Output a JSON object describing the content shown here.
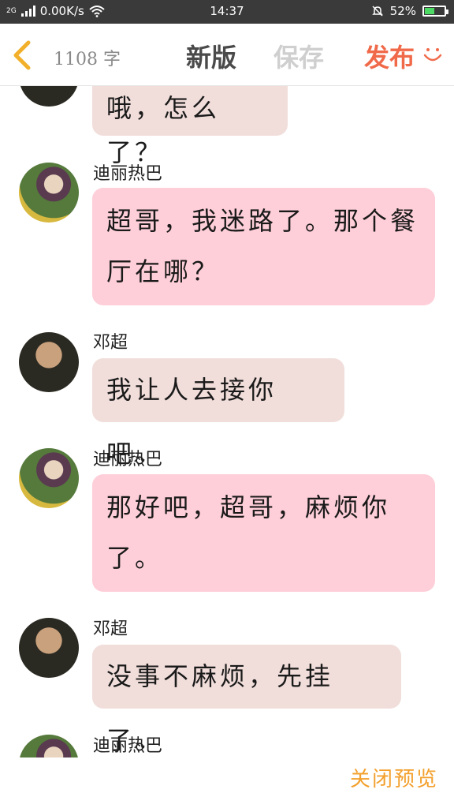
{
  "status_bar": {
    "network": "2G",
    "speed": "0.00K/s",
    "time": "14:37",
    "battery": "52%",
    "battery_level": 0.52
  },
  "header": {
    "back_icon": "chevron-left-icon",
    "word_count": "1108 字",
    "new_version_label": "新版",
    "save_label": "保存",
    "publish_label": "发布",
    "smile_icon": "smile-icon"
  },
  "messages": [
    {
      "speaker": "",
      "text": "哦，怎么了？"
    },
    {
      "speaker": "迪丽热巴",
      "lines": [
        "超哥，我迷路了。那个餐",
        "厅在哪？"
      ]
    },
    {
      "speaker": "邓超",
      "text": "我让人去接你吧。"
    },
    {
      "speaker": "迪丽热巴",
      "lines": [
        "那好吧，超哥，麻烦你",
        "了。"
      ]
    },
    {
      "speaker": "邓超",
      "text": "没事不麻烦，先挂了。"
    },
    {
      "speaker": "迪丽热巴",
      "text": ""
    }
  ],
  "footer": {
    "close_preview_label": "关闭预览"
  },
  "colors": {
    "status_bg": "#3a3a3a",
    "male_bubble": "#f1dedb",
    "female_bubble": "#fecfd9",
    "publish": "#f06a4a",
    "close_preview": "#f3a02d"
  }
}
